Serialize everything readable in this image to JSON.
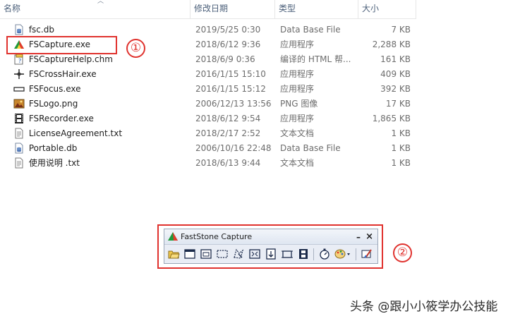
{
  "columns": {
    "name": "名称",
    "date": "修改日期",
    "type": "类型",
    "size": "大小"
  },
  "files": [
    {
      "name": "fsc.db",
      "date": "2019/5/25 0:30",
      "type": "Data Base File",
      "size": "7 KB",
      "icon": "db-file-icon"
    },
    {
      "name": "FSCapture.exe",
      "date": "2018/6/12 9:36",
      "type": "应用程序",
      "size": "2,288 KB",
      "icon": "faststone-app-icon"
    },
    {
      "name": "FSCaptureHelp.chm",
      "date": "2018/6/9 0:36",
      "type": "编译的 HTML 帮...",
      "size": "161 KB",
      "icon": "chm-help-icon"
    },
    {
      "name": "FSCrossHair.exe",
      "date": "2016/1/15 15:10",
      "type": "应用程序",
      "size": "409 KB",
      "icon": "crosshair-icon"
    },
    {
      "name": "FSFocus.exe",
      "date": "2016/1/15 15:12",
      "type": "应用程序",
      "size": "392 KB",
      "icon": "focus-bar-icon"
    },
    {
      "name": "FSLogo.png",
      "date": "2006/12/13 13:56",
      "type": "PNG 图像",
      "size": "17 KB",
      "icon": "png-image-icon"
    },
    {
      "name": "FSRecorder.exe",
      "date": "2018/6/12 9:54",
      "type": "应用程序",
      "size": "1,865 KB",
      "icon": "film-recorder-icon"
    },
    {
      "name": "LicenseAgreement.txt",
      "date": "2018/2/17 2:52",
      "type": "文本文档",
      "size": "1 KB",
      "icon": "text-file-icon"
    },
    {
      "name": "Portable.db",
      "date": "2006/10/16 22:48",
      "type": "Data Base File",
      "size": "1 KB",
      "icon": "db-file-icon"
    },
    {
      "name": "使用说明 .txt",
      "date": "2018/6/13 9:44",
      "type": "文本文档",
      "size": "1 KB",
      "icon": "text-file-icon"
    }
  ],
  "callouts": {
    "one": "①",
    "two": "②"
  },
  "faststone": {
    "title": "FastStone Capture",
    "minimize": "–",
    "close": "×",
    "tools": [
      "open-folder-icon",
      "capture-window-icon",
      "capture-object-icon",
      "capture-rectangle-icon",
      "capture-freehand-icon",
      "capture-fullscreen-icon",
      "capture-scrolling-icon",
      "capture-fixed-region-icon",
      "screen-recorder-icon",
      "delay-timer-icon",
      "output-palette-icon",
      "settings-brush-icon"
    ]
  },
  "watermark": "头条 @跟小小筱学办公技能",
  "colors": {
    "callout_red": "#e0322e",
    "header_text": "#4c607a"
  }
}
